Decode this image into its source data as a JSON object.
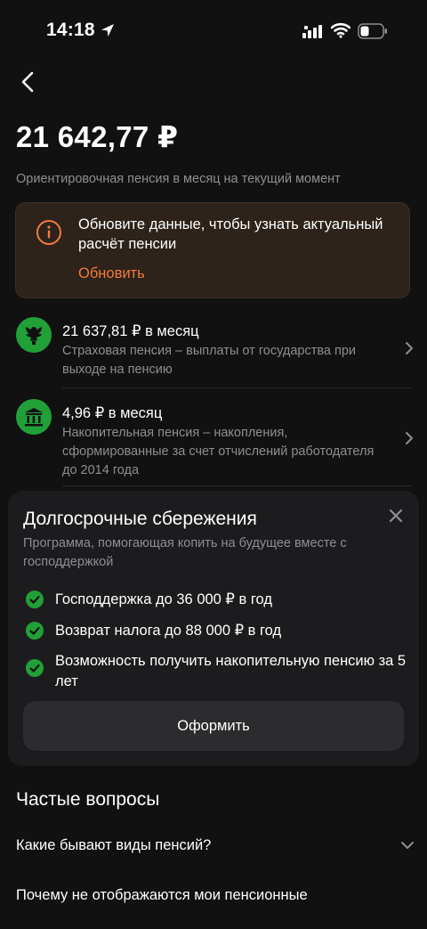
{
  "status_bar": {
    "time": "14:18",
    "icons": [
      "location-arrow-icon",
      "cellular-signal-icon",
      "wifi-icon",
      "battery-icon"
    ]
  },
  "header": {
    "back_icon": "chevron-left-icon"
  },
  "summary": {
    "amount": "21 642,77 ₽",
    "description": "Ориентировочная пенсия в месяц на текущий момент"
  },
  "warning": {
    "icon": "info-icon",
    "text": "Обновите данные, чтобы узнать актуальный расчёт пенсии",
    "action": "Обновить",
    "accent_color": "#f47a3c"
  },
  "pensions": [
    {
      "icon": "eagle-emblem-icon",
      "title": "21 637,81 ₽ в месяц",
      "subtitle": "Страховая пенсия – выплаты от государства при выходе на пенсию"
    },
    {
      "icon": "bank-building-icon",
      "title": "4,96 ₽ в месяц",
      "subtitle": "Накопительная пенсия – накопления, сформированные за счет отчислений работодателя до 2014 года"
    }
  ],
  "sheet": {
    "title": "Долгосрочные сбережения",
    "subtitle": "Программа, помогающая копить на будущее вместе с господдержкой",
    "benefits": [
      "Господдержка до 36 000 ₽ в год",
      "Возврат налога до 88 000 ₽ в год",
      "Возможность получить накопительную пенсию за 5 лет"
    ],
    "button": "Оформить",
    "brand_color": "#21a038"
  },
  "faq": {
    "title": "Частые вопросы",
    "questions": [
      "Какие бывают виды пенсий?",
      "Почему не отображаются мои пенсионные"
    ]
  }
}
